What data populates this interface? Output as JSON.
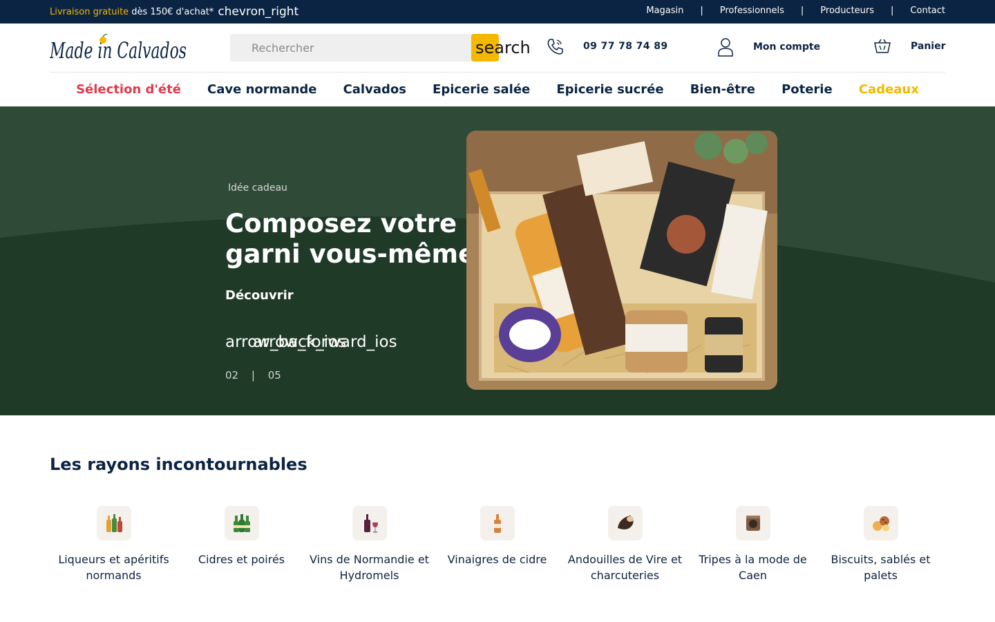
{
  "topbar": {
    "promo_highlight": "Livraison gratuite",
    "promo_rest": "dès 150€ d'achat*",
    "promo_icon": "chevron_right",
    "links": [
      "Magasin",
      "Professionnels",
      "Producteurs",
      "Contact"
    ],
    "separator": "|"
  },
  "header": {
    "logo_text": "Made in Calvados",
    "search_placeholder": "Rechercher",
    "search_button": "search",
    "phone": "09 77 78 74 89",
    "account": "Mon compte",
    "cart": "Panier"
  },
  "nav": {
    "items": [
      "Sélection d'été",
      "Cave normande",
      "Calvados",
      "Epicerie salée",
      "Epicerie sucrée",
      "Bien-être",
      "Poterie",
      "Cadeaux"
    ]
  },
  "hero": {
    "eyebrow": "Idée cadeau",
    "title": "Composez votre panier garni vous-même",
    "cta": "Découvrir",
    "arrow_prev": "arrow_back_ios",
    "arrow_next": "arrow_forward_ios",
    "current_slide": "02",
    "pager_sep": "|",
    "total_slides": "05",
    "colors": {
      "background": "#203a27",
      "wave": "#2f4a36"
    }
  },
  "categories": {
    "title": "Les rayons incontournables",
    "items": [
      {
        "label": "Liqueurs et apéritifs normands",
        "icon": "bottles-icon"
      },
      {
        "label": "Cidres et poirés",
        "icon": "cider-bottles-icon"
      },
      {
        "label": "Vins de Normandie et Hydromels",
        "icon": "wine-icon"
      },
      {
        "label": "Vinaigres de cidre",
        "icon": "vinegar-icon"
      },
      {
        "label": "Andouilles de Vire et charcuteries",
        "icon": "sausage-icon"
      },
      {
        "label": "Tripes à la mode de Caen",
        "icon": "tripe-jar-icon"
      },
      {
        "label": "Biscuits, sablés et palets",
        "icon": "biscuits-icon"
      }
    ]
  },
  "colors": {
    "navy": "#0b2443",
    "yellow": "#f5b800",
    "red": "#e0394a"
  }
}
